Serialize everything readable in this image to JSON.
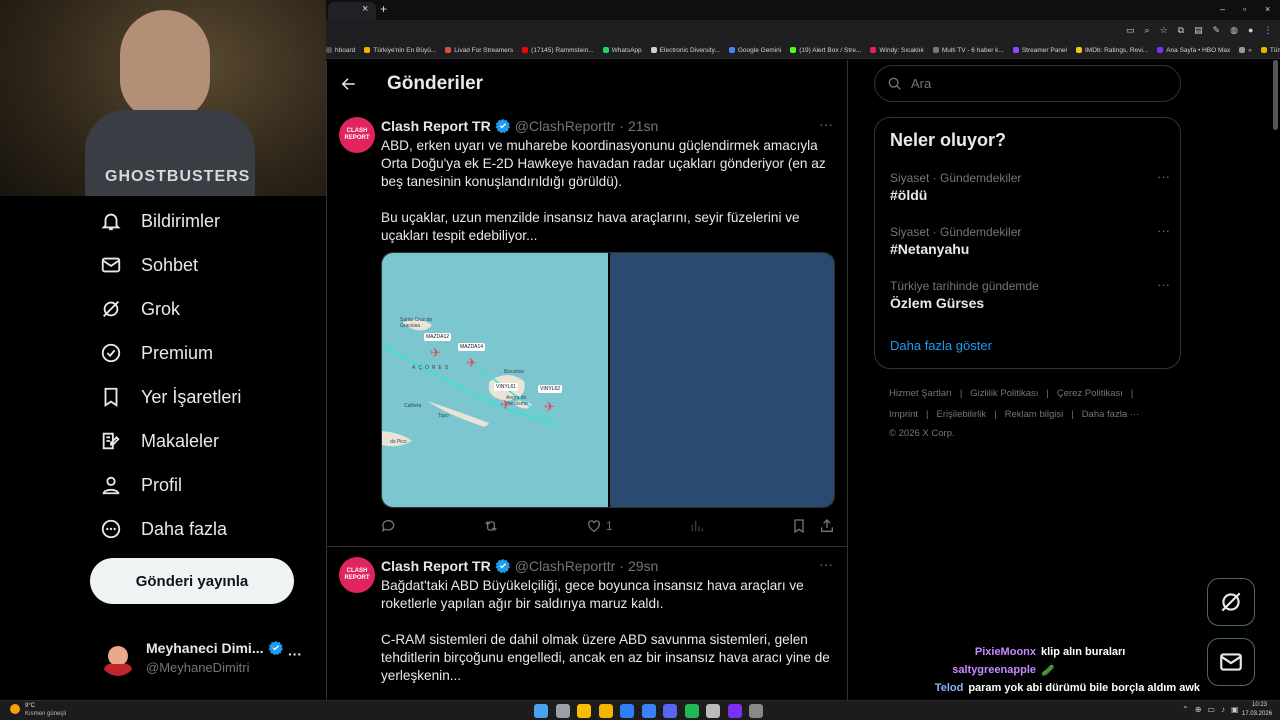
{
  "browser": {
    "bookmarks": [
      "hboard",
      "Türkiye'nin En Büyü...",
      "Livad For Streamers",
      "(17145) Rammstein...",
      "WhatsApp",
      "Electronic Diversity...",
      "Google Gemini",
      "(19) Alert Box / Stre...",
      "Windy: Sıcaklık",
      "Multi TV - 6 haber k...",
      "Streamer Panel",
      "IMDb: Ratings, Revi...",
      "Ana Sayfa • HBO Max",
      "»",
      "Tüm Yer İşaretleri"
    ],
    "bookmark_colors": [
      "#555",
      "#f0b400",
      "#e84545",
      "#ff0000",
      "#25d366",
      "#cfcfcf",
      "#4285f4",
      "#53fc18",
      "#e91e63",
      "#777",
      "#9146ff",
      "#f5c518",
      "#7b2ff7",
      "#999",
      "#f0b400"
    ],
    "tab_close": "×",
    "new_tab": "+"
  },
  "nav": {
    "items": [
      {
        "label": "Bildirimler",
        "icon": "bell-icon"
      },
      {
        "label": "Sohbet",
        "icon": "mail-icon"
      },
      {
        "label": "Grok",
        "icon": "grok-icon"
      },
      {
        "label": "Premium",
        "icon": "verified-badge-icon"
      },
      {
        "label": "Yer İşaretleri",
        "icon": "bookmark-icon"
      },
      {
        "label": "Makaleler",
        "icon": "article-icon"
      },
      {
        "label": "Profil",
        "icon": "person-icon"
      },
      {
        "label": "Daha fazla",
        "icon": "more-circle-icon"
      }
    ],
    "post_button": "Gönderi yayınla",
    "account": {
      "name": "Meyhaneci Dimi...",
      "handle": "@MeyhaneDimitri",
      "more": "···"
    }
  },
  "header": {
    "title": "Gönderiler",
    "back_icon": "arrow-left-icon"
  },
  "tweets": [
    {
      "name": "Clash Report TR",
      "handle": "@ClashReporttr",
      "dot": "·",
      "time": "21sn",
      "text": "ABD, erken uyarı ve muharebe koordinasyonunu güçlendirmek amacıyla Orta Doğu'ya ek E-2D Hawkeye havadan radar uçakları gönderiyor (en az beş tanesinin konuşlandırıldığı görüldü).\n\nBu uçaklar, uzun menzilde insansız hava araçlarını, seyir füzelerini ve uçakları tespit edebiliyor...",
      "likes": "1",
      "map_labels": [
        "Santa Cruz da Graciosa",
        "MAZDA12",
        "MAZDA14",
        "AÇORES",
        "Biscoitos",
        "Angra do Heroísmo",
        "VINYL61",
        "VINYL62",
        "Calheta",
        "Topo",
        "do Pico"
      ]
    },
    {
      "name": "Clash Report TR",
      "handle": "@ClashReporttr",
      "dot": "·",
      "time": "29sn",
      "text": "Bağdat'taki ABD Büyükelçiliği, gece boyunca insansız hava araçları ve roketlerle yapılan ağır bir saldırıya maruz kaldı.\n\nC-RAM sistemleri de dahil olmak üzere ABD savunma sistemleri, gelen tehditlerin birçoğunu engelledi, ancak en az bir insansız hava aracı yine de yerleşkenin..."
    }
  ],
  "avatar_text": "CLASH REPORT",
  "search": {
    "placeholder": "Ara"
  },
  "trends": {
    "title": "Neler oluyor?",
    "items": [
      {
        "category": "Siyaset · Gündemdekiler",
        "name": "#öldü"
      },
      {
        "category": "Siyaset · Gündemdekiler",
        "name": "#Netanyahu"
      },
      {
        "category": "Türkiye tarihinde gündemde",
        "name": "Özlem Gürses"
      }
    ],
    "show_more": "Daha fazla göster"
  },
  "footer": {
    "row1": [
      "Hizmet Şartları",
      "|",
      "Gizlilik Politikası",
      "|",
      "Çerez Politikası",
      "|"
    ],
    "row2": [
      "Imprint",
      "|",
      "Erişilebilirlik",
      "|",
      "Reklam bilgisi",
      "|",
      "Daha fazla ···"
    ],
    "copyright": "© 2026 X Corp."
  },
  "chat": [
    {
      "user": "PixieMoonx",
      "message": "klip alın buraları",
      "color": "#c58bff"
    },
    {
      "user": "saltygreenapple",
      "message": "🥒",
      "color": "#c58bff"
    },
    {
      "user": "Telod",
      "message": "param yok abi dürümü bile borçla aldım awk",
      "color": "#8ab4f8"
    }
  ],
  "taskbar": {
    "weather_temp": "9°C",
    "weather_desc": "Kısmen güneşli",
    "time": "10:23",
    "date": "17.03.2026"
  },
  "webcam_shirt": "GHOSTBUSTERS",
  "colors": {
    "accent": "#1d9bf0",
    "map_sea": "#7cc6cf",
    "map_dark": "#2b4a6f",
    "verified": "#1d9bf0"
  }
}
